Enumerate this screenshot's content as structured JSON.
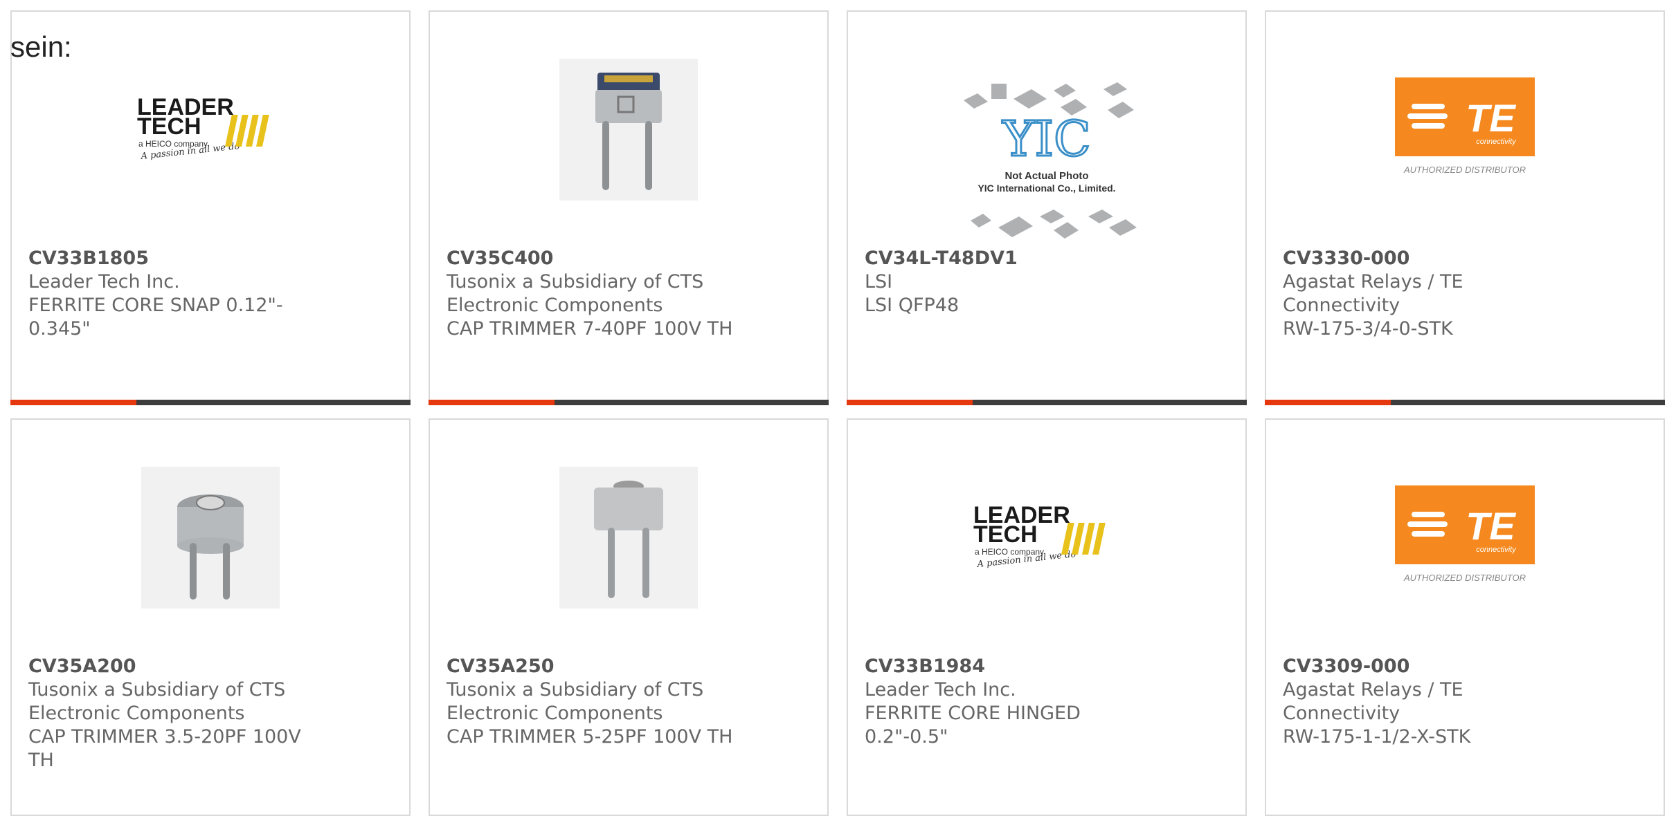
{
  "intro_text": "sein:",
  "products": [
    {
      "part": "CV33B1805",
      "maker": "Leader Tech Inc.",
      "desc_lines": [
        "FERRITE CORE SNAP 0.12\"-",
        "0.345\""
      ],
      "image": "leader-tech-logo"
    },
    {
      "part": "CV35C400",
      "maker_lines": [
        "Tusonix a Subsidiary of CTS",
        "Electronic Components"
      ],
      "desc": "CAP TRIMMER 7-40PF 100V TH",
      "image": "trimmer-cap-photo"
    },
    {
      "part": "CV34L-T48DV1",
      "maker": "LSI",
      "desc": "LSI QFP48",
      "image": "yic-placeholder"
    },
    {
      "part": "CV3330-000",
      "maker": "Agastat Relays / TE Connectivity",
      "desc": "RW-175-3/4-0-STK",
      "image": "te-logo"
    },
    {
      "part": "CV35A200",
      "maker_lines": [
        "Tusonix a Subsidiary of CTS",
        "Electronic Components"
      ],
      "desc": "CAP TRIMMER 3.5-20PF 100V TH",
      "image": "trimmer-cap-photo"
    },
    {
      "part": "CV35A250",
      "maker_lines": [
        "Tusonix a Subsidiary of CTS",
        "Electronic Components"
      ],
      "desc": "CAP TRIMMER 5-25PF 100V TH",
      "image": "trimmer-cap-photo"
    },
    {
      "part": "CV33B1984",
      "maker": "Leader Tech Inc.",
      "desc": "FERRITE CORE HINGED 0.2\"-0.5\"",
      "image": "leader-tech-logo"
    },
    {
      "part": "CV3309-000",
      "maker": "Agastat Relays / TE Connectivity",
      "desc": "RW-175-1-1/2-X-STK",
      "image": "te-logo"
    }
  ],
  "logos": {
    "leader_tech": {
      "line1": "LEADER",
      "line2": "TECH",
      "sub": "a HEICO company",
      "tagline": "A passion in all we do"
    },
    "te": {
      "mark": "TE",
      "sub": "connectivity",
      "caption": "AUTHORIZED DISTRIBUTOR"
    },
    "yic": {
      "mark": "YIC",
      "line1": "Not Actual Photo",
      "line2": "YIC International Co., Limited."
    }
  },
  "colors": {
    "accent": "#e5380f",
    "bar": "#3d3d3d",
    "border": "#d9d9d9",
    "te_orange": "#f5891f",
    "leader_yellow": "#e8c21b"
  }
}
